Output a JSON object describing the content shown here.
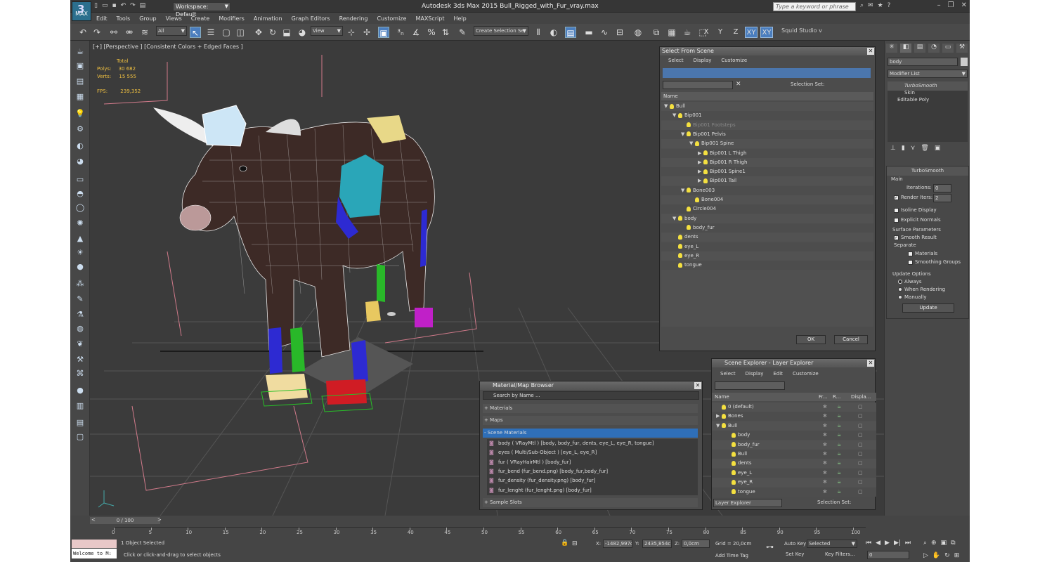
{
  "app": {
    "logo_label": "MAX",
    "title": "Autodesk 3ds Max  2015    Bull_Rigged_with_Fur_vray.max",
    "workspace": "Workspace: Default",
    "help_search_placeholder": "Type a keyword or phrase"
  },
  "menu": [
    "Edit",
    "Tools",
    "Group",
    "Views",
    "Create",
    "Modifiers",
    "Animation",
    "Graph Editors",
    "Rendering",
    "Customize",
    "MAXScript",
    "Help"
  ],
  "toolbar": {
    "selection_filter": "All",
    "ref_coord": "View",
    "named_selection": "Create Selection Se",
    "axis": [
      "X",
      "Y",
      "Z",
      "XY",
      "XY"
    ],
    "squid": "Squid Studio v"
  },
  "viewport": {
    "label": "[+] [Perspective ] [Consistent Colors + Edged Faces ]",
    "stats_header": "Total",
    "polys_label": "Polys:",
    "polys_value": "30 682",
    "verts_label": "Verts:",
    "verts_value": "15 555",
    "fps_label": "FPS:",
    "fps_value": "239,352"
  },
  "select_from_scene": {
    "title": "Select From Scene",
    "menu": [
      "Select",
      "Display",
      "Customize"
    ],
    "selection_set_label": "Selection Set:",
    "column_name": "Name",
    "tree": [
      {
        "name": "Bull",
        "depth": 0,
        "exp": "▼"
      },
      {
        "name": "Bip001",
        "depth": 1,
        "exp": "▼"
      },
      {
        "name": "Bip001 Footsteps",
        "depth": 2,
        "exp": "",
        "dim": true
      },
      {
        "name": "Bip001 Pelvis",
        "depth": 2,
        "exp": "▼"
      },
      {
        "name": "Bip001 Spine",
        "depth": 3,
        "exp": "▼"
      },
      {
        "name": "Bip001 L Thigh",
        "depth": 4,
        "exp": "▶"
      },
      {
        "name": "Bip001 R Thigh",
        "depth": 4,
        "exp": "▶"
      },
      {
        "name": "Bip001 Spine1",
        "depth": 4,
        "exp": "▶"
      },
      {
        "name": "Bip001 Tail",
        "depth": 4,
        "exp": "▶"
      },
      {
        "name": "Bone003",
        "depth": 2,
        "exp": "▼"
      },
      {
        "name": "Bone004",
        "depth": 3,
        "exp": ""
      },
      {
        "name": "Circle004",
        "depth": 2,
        "exp": ""
      },
      {
        "name": "body",
        "depth": 1,
        "exp": "▼"
      },
      {
        "name": "body_fur",
        "depth": 2,
        "exp": ""
      },
      {
        "name": "dents",
        "depth": 1,
        "exp": ""
      },
      {
        "name": "eye_L",
        "depth": 1,
        "exp": ""
      },
      {
        "name": "eye_R",
        "depth": 1,
        "exp": ""
      },
      {
        "name": "tongue",
        "depth": 1,
        "exp": ""
      }
    ],
    "ok": "OK",
    "cancel": "Cancel"
  },
  "scene_explorer": {
    "title": "Scene Explorer - Layer Explorer",
    "menu": [
      "Select",
      "Display",
      "Edit",
      "Customize"
    ],
    "columns": [
      "Name",
      "Fr...",
      "R...",
      "Displa..."
    ],
    "rows": [
      {
        "name": "0 (default)",
        "depth": 0,
        "exp": ""
      },
      {
        "name": "Bones",
        "depth": 0,
        "exp": "▶"
      },
      {
        "name": "Bull",
        "depth": 0,
        "exp": "▼"
      },
      {
        "name": "body",
        "depth": 1,
        "exp": ""
      },
      {
        "name": "body_fur",
        "depth": 1,
        "exp": ""
      },
      {
        "name": "Bull",
        "depth": 1,
        "exp": ""
      },
      {
        "name": "dents",
        "depth": 1,
        "exp": ""
      },
      {
        "name": "eye_L",
        "depth": 1,
        "exp": ""
      },
      {
        "name": "eye_R",
        "depth": 1,
        "exp": ""
      },
      {
        "name": "tongue",
        "depth": 1,
        "exp": ""
      }
    ],
    "footer_explorer": "Layer Explorer",
    "footer_selection": "Selection Set:"
  },
  "material_browser": {
    "title": "Material/Map Browser",
    "search_placeholder": "Search by Name ...",
    "sections": [
      "+ Materials",
      "+ Maps",
      "- Scene Materials",
      "+ Sample Slots"
    ],
    "items": [
      "body  ( VRayMtl ) [body, body_fur, dents, eye_L, eye_R, tongue]",
      "eyes  ( Multi/Sub-Object ) [eye_L, eye_R]",
      "fur  ( VRayHairMtl ) [body_fur]",
      "fur_bend (fur_bend.png) [body_fur,body_fur]",
      "fur_density (fur_density.png) [body_fur]",
      "fur_lenght (fur_lenght.png) [body_fur]"
    ]
  },
  "command_panel": {
    "object_name": "body",
    "modifier_list": "Modifier List",
    "stack": [
      "TurboSmooth",
      "Skin",
      "Editable Poly"
    ],
    "rollout_title": "TurboSmooth",
    "main_label": "Main",
    "iterations_label": "Iterations:",
    "iterations_value": "0",
    "render_iters_label": "Render Iters:",
    "render_iters_value": "2",
    "isoline_label": "Isoline Display",
    "explicit_label": "Explicit Normals",
    "surface_label": "Surface Parameters",
    "smooth_result_label": "Smooth Result",
    "separate_label": "Separate",
    "materials_label": "Materials",
    "smoothing_groups_label": "Smoothing Groups",
    "update_options_label": "Update Options",
    "always_label": "Always",
    "when_rendering_label": "When Rendering",
    "manually_label": "Manually",
    "update_button": "Update"
  },
  "timeline": {
    "frame_counter": "0 / 100",
    "ticks": [
      "0",
      "5",
      "10",
      "15",
      "20",
      "25",
      "30",
      "35",
      "40",
      "45",
      "50",
      "55",
      "60",
      "65",
      "70",
      "75",
      "80",
      "85",
      "90",
      "95",
      "100"
    ]
  },
  "status": {
    "maxscript": "Welcome to M:",
    "selected": "1 Object Selected",
    "prompt": "Click or click-and-drag to select objects",
    "x_label": "X:",
    "x_value": "-1482,997c",
    "y_label": "Y:",
    "y_value": "2435,854c",
    "z_label": "Z:",
    "z_value": "0,0cm",
    "grid": "Grid = 20,0cm",
    "add_time_tag": "Add Time Tag",
    "auto_key": "Auto Key",
    "set_key": "Set Key",
    "key_mode": "Selected",
    "key_filters": "Key Filters...",
    "frame": "0"
  }
}
